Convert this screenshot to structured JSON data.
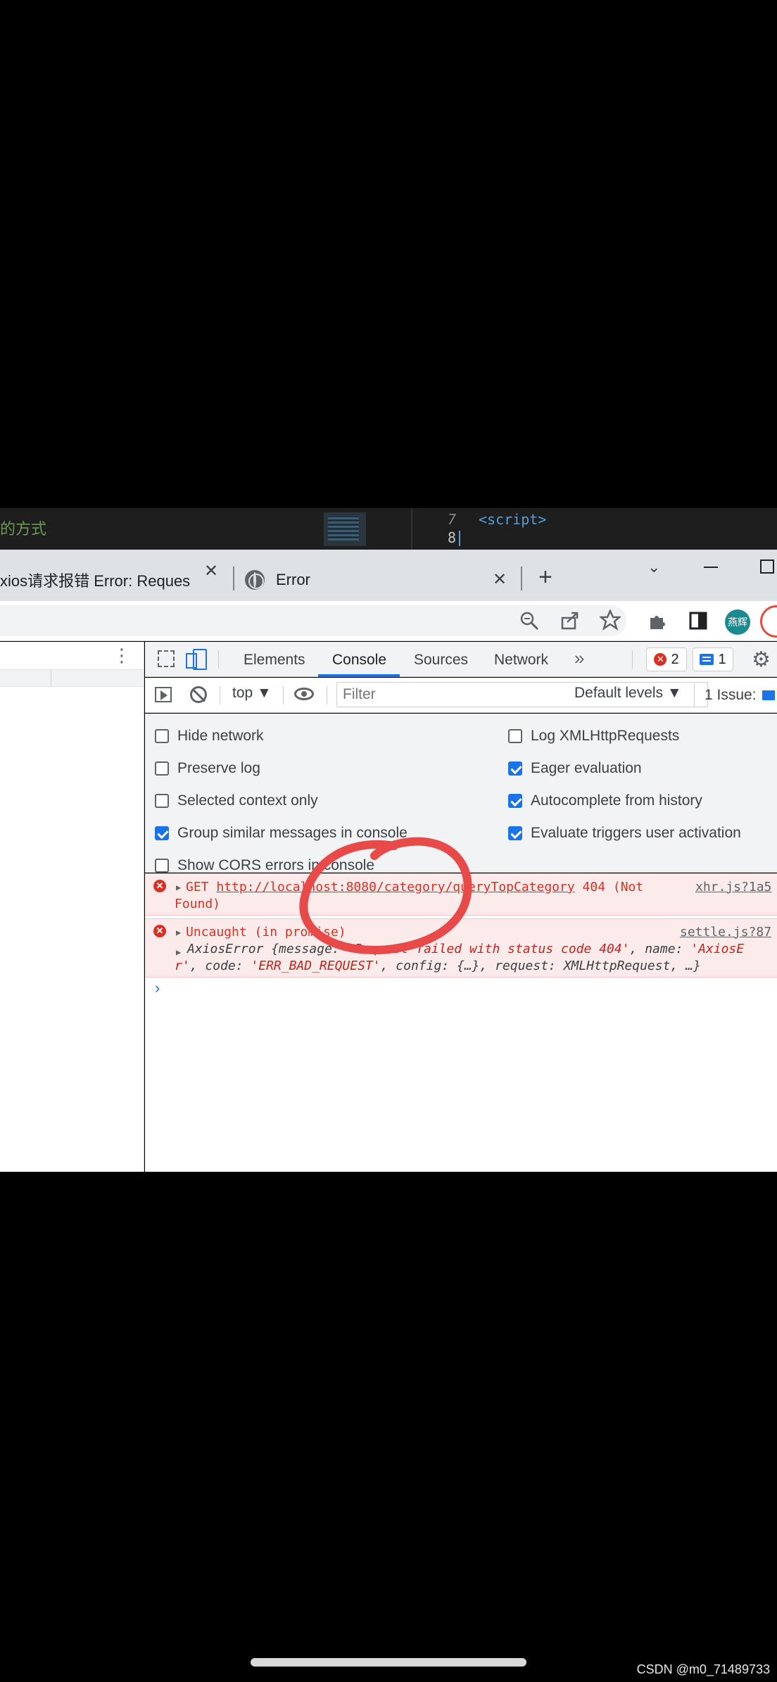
{
  "editor": {
    "left_text": "的方式",
    "line7_num": "7",
    "line7_code": "<script>",
    "line8_num": "8"
  },
  "browser": {
    "tab1_title": "xios请求报错 Error: Request f",
    "tab2_title": "Error",
    "close_glyph": "✕",
    "new_tab_glyph": "+",
    "tab_menu_glyph": "⌄",
    "avatar_text": "燕辉"
  },
  "devtools": {
    "tabs": [
      "Elements",
      "Console",
      "Sources",
      "Network"
    ],
    "more_tabs": "»",
    "error_count": "2",
    "message_count": "1",
    "context": "top ▼",
    "filter_placeholder": "Filter",
    "levels": "Default levels ▼",
    "issues": "1 Issue:",
    "settings": {
      "left": [
        {
          "label": "Hide network",
          "checked": false
        },
        {
          "label": "Preserve log",
          "checked": false
        },
        {
          "label": "Selected context only",
          "checked": false
        },
        {
          "label": "Group similar messages in console",
          "checked": true
        },
        {
          "label": "Show CORS errors in console",
          "checked": false
        }
      ],
      "right": [
        {
          "label": "Log XMLHttpRequests",
          "checked": false
        },
        {
          "label": "Eager evaluation",
          "checked": true
        },
        {
          "label": "Autocomplete from history",
          "checked": true
        },
        {
          "label": "Evaluate triggers user activation",
          "checked": true
        }
      ]
    }
  },
  "console": {
    "msg1": {
      "method": "GET ",
      "url": "http://localhost:8080/category/queryTopCategory",
      "status": " 404 (Not",
      "status_cont": "Found)",
      "source": "xhr.js?1a5"
    },
    "msg2": {
      "title": "Uncaught (in promise)",
      "source": "settle.js?87",
      "line1_a": "AxiosError {message: ",
      "line1_s": "'Request failed with status code 404'",
      "line1_b": ", name: ",
      "line1_s2": "'AxiosE",
      "line2_s": "r'",
      "line2_a": ", code: ",
      "line2_s2": "'ERR_BAD_REQUEST'",
      "line2_b": ", config: {…}, request: XMLHttpRequest, …}"
    },
    "prompt": "›"
  },
  "watermark": "CSDN @m0_71489733",
  "annotation_color": "#e84a4a"
}
